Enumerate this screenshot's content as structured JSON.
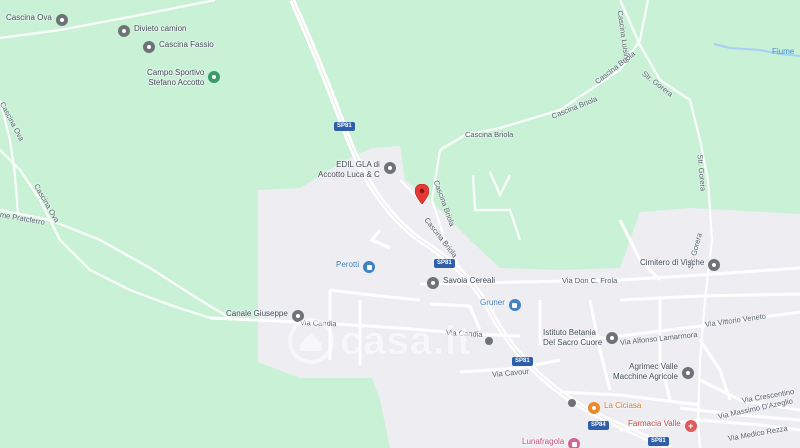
{
  "map": {
    "colors": {
      "land": "#c9f1d6",
      "urban": "#eeedf2",
      "road": "#ffffff",
      "water": "#a6d0f5",
      "accent_marker": "#e53935"
    },
    "pois": {
      "cascina_ova": "Cascina Ova",
      "divieto_camion": "Divieto camion",
      "cascina_fassio": "Cascina Fassio",
      "campo_sportivo_line1": "Campo Sportivo",
      "campo_sportivo_line2": "Stefano Accotto",
      "edil_line1": "EDIL GLA di",
      "edil_line2": "Accotto Luca & C",
      "perotti": "Perotti",
      "savoia_cereali": "Savoia Cereali",
      "gruner": "Gruner",
      "canale_giuseppe": "Canale Giuseppe",
      "cimitero": "Cimitero di Vische",
      "istituto_line1": "Istituto Betania",
      "istituto_line2": "Del Sacro Cuore",
      "agrimec_line1": "Agrimec Valle",
      "agrimec_line2": "Macchine Agricole",
      "la_ciciasa": "La Ciciasa",
      "farmacia": "Farmacia Valle",
      "lunafragola": "Lunafragola"
    },
    "roads": {
      "cascina_luisina": "Cascina Luisina",
      "str_gorera_top": "Str. Gorera",
      "str_gorera_right": "Str. Gorera",
      "str_gorera_low": "Str. Gorera",
      "cascina_briola_top": "Cascina Briola",
      "cascina_briola_label": "Cascina Briola",
      "cascina_briola_a": "Cascina Briola",
      "cascina_briola_b": "Cascina Briola",
      "cascina_briola_c": "Cascina Briola",
      "cascina_ova_road": "Cascina Ova",
      "cascina_ova_road2": "Cascina Ova",
      "pratcferro": "me Pratcferro",
      "via_candia_1": "Via Candia",
      "via_candia_2": "Via Candia",
      "via_don_frola": "Via Don C. Frola",
      "via_alfonso": "Via Alfonso Lamarmora",
      "via_vittorio": "Via Vittorio Veneto",
      "via_cavour": "Via Cavour",
      "via_crescentino": "Via Crescentino",
      "via_massimo": "Via Massimo D'Azeglio",
      "via_medico": "Via Medico Rezza"
    },
    "shields": {
      "sp81_top": "SP81",
      "sp81_mid": "SP81",
      "sp81_low": "SP81",
      "sp84": "SP84",
      "sp81_bottom": "SP81"
    },
    "water_label": "Fiume",
    "watermark_text": "casa.it"
  }
}
